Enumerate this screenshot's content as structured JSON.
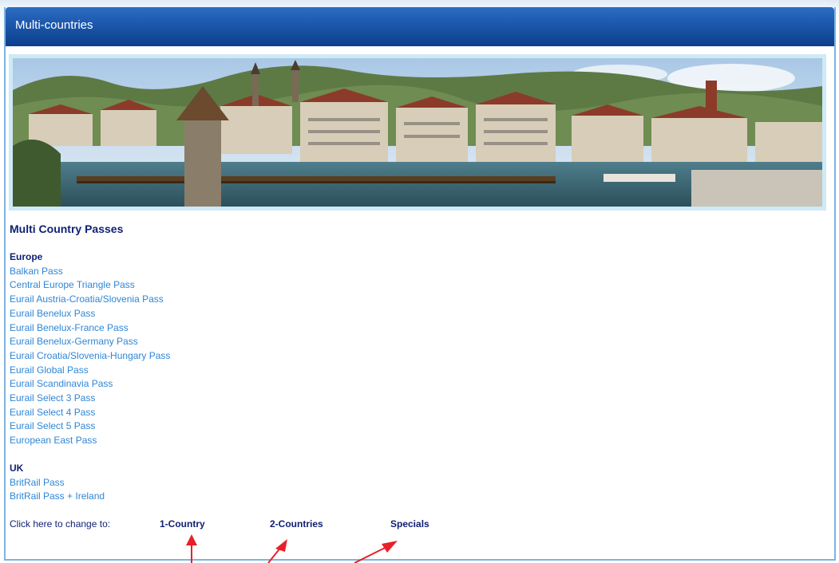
{
  "header": {
    "title": "Multi-countries"
  },
  "main": {
    "section_title": "Multi Country Passes",
    "groups": [
      {
        "heading": "Europe",
        "links": [
          "Balkan Pass",
          "Central Europe Triangle Pass",
          "Eurail Austria-Croatia/Slovenia Pass",
          "Eurail Benelux Pass",
          "Eurail Benelux-France Pass",
          "Eurail Benelux-Germany Pass",
          "Eurail Croatia/Slovenia-Hungary Pass",
          "Eurail Global Pass",
          "Eurail Scandinavia Pass",
          "Eurail Select 3 Pass",
          "Eurail Select 4 Pass",
          "Eurail Select 5 Pass",
          "European East Pass"
        ]
      },
      {
        "heading": "UK",
        "links": [
          "BritRail Pass",
          "BritRail Pass + Ireland"
        ]
      }
    ]
  },
  "change": {
    "label": "Click here to change to:",
    "options": [
      "1-Country",
      "2-Countries",
      "Specials"
    ]
  },
  "colors": {
    "header_blue": "#1b57ab",
    "link_blue": "#2f86d6",
    "heading_navy": "#0f1f73",
    "annotation_red": "#e8202a"
  }
}
